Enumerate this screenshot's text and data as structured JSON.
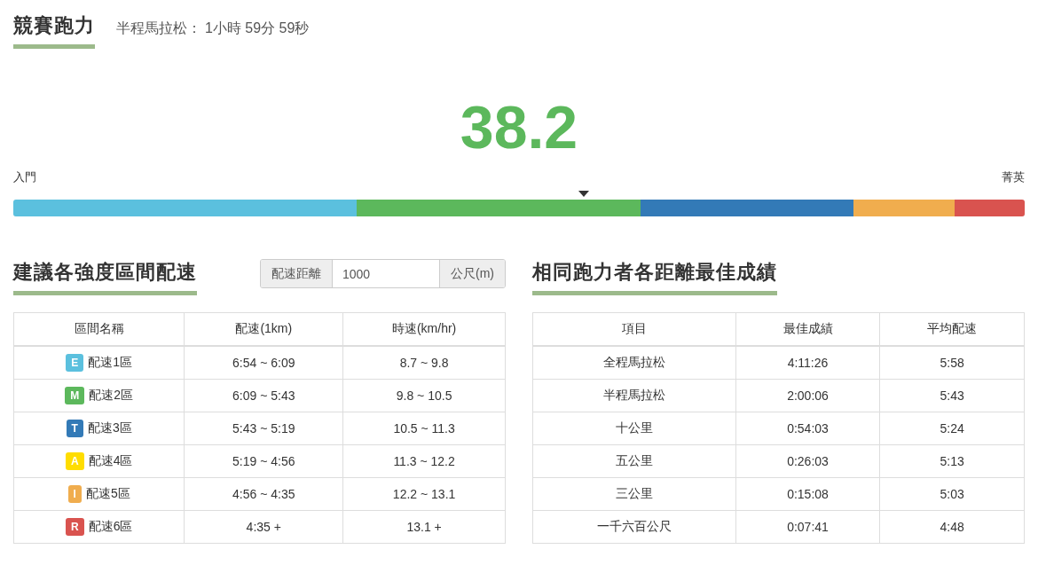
{
  "header": {
    "title": "競賽跑力",
    "race": "半程馬拉松：",
    "time": "1小時 59分 59秒"
  },
  "score": "38.2",
  "scale": {
    "low_label": "入門",
    "high_label": "菁英",
    "marker": {
      "level": 0.564
    },
    "segments": [
      {
        "color": "#5bc0de"
      },
      {
        "color": "#5cb85c"
      },
      {
        "color": "#337ab7"
      },
      {
        "color": "#f0ad4e"
      },
      {
        "color": "#d9534f"
      }
    ]
  },
  "pace_section": {
    "title": "建議各強度區間配速",
    "distance_field": {
      "label": "配速距離",
      "value": "1000",
      "unit": "公尺(m)"
    },
    "columns": [
      "區間名稱",
      "配速(1km)",
      "時速(km/hr)"
    ],
    "rows": [
      {
        "badge": "E",
        "color": "#5bc0de",
        "zone": "配速1區",
        "pace": "6:54 ~ 6:09",
        "speed": "8.7 ~ 9.8"
      },
      {
        "badge": "M",
        "color": "#5cb85c",
        "zone": "配速2區",
        "pace": "6:09 ~ 5:43",
        "speed": "9.8 ~ 10.5"
      },
      {
        "badge": "T",
        "color": "#337ab7",
        "zone": "配速3區",
        "pace": "5:43 ~ 5:19",
        "speed": "10.5 ~ 11.3"
      },
      {
        "badge": "A",
        "color": "#ffdd00",
        "zone": "配速4區",
        "pace": "5:19 ~ 4:56",
        "speed": "11.3 ~ 12.2"
      },
      {
        "badge": "I",
        "color": "#f0ad4e",
        "zone": "配速5區",
        "pace": "4:56 ~ 4:35",
        "speed": "12.2 ~ 13.1"
      },
      {
        "badge": "R",
        "color": "#d9534f",
        "zone": "配速6區",
        "pace": "4:35 +",
        "speed": "13.1 +"
      }
    ]
  },
  "best_section": {
    "title": "相同跑力者各距離最佳成績",
    "columns": [
      "項目",
      "最佳成績",
      "平均配速"
    ],
    "rows": [
      {
        "event": "全程馬拉松",
        "best": "4:11:26",
        "pace": "5:58"
      },
      {
        "event": "半程馬拉松",
        "best": "2:00:06",
        "pace": "5:43"
      },
      {
        "event": "十公里",
        "best": "0:54:03",
        "pace": "5:24"
      },
      {
        "event": "五公里",
        "best": "0:26:03",
        "pace": "5:13"
      },
      {
        "event": "三公里",
        "best": "0:15:08",
        "pace": "5:03"
      },
      {
        "event": "一千六百公尺",
        "best": "0:07:41",
        "pace": "4:48"
      }
    ]
  }
}
